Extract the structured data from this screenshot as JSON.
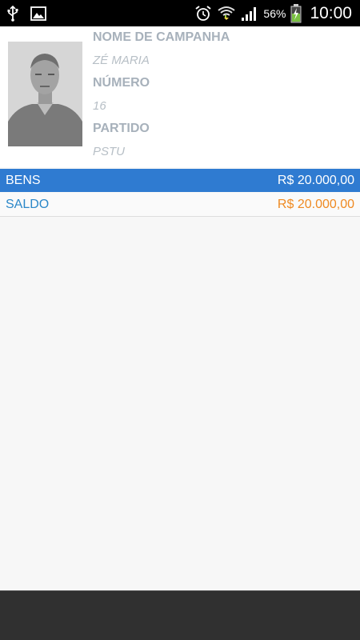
{
  "status_bar": {
    "icons_left": [
      "usb-icon",
      "image-icon"
    ],
    "icons_right": [
      "alarm-icon",
      "wifi-icon",
      "signal-icon",
      "battery-charging-icon"
    ],
    "battery_percent": "56%",
    "time": "10:00"
  },
  "candidate": {
    "campaign_name_label": "NOME DE CAMPANHA",
    "campaign_name": "ZÉ MARIA",
    "number_label": "NÚMERO",
    "number": "16",
    "party_label": "PARTIDO",
    "party": "PSTU"
  },
  "rows": {
    "bens": {
      "label": "BENS",
      "value": "R$ 20.000,00"
    },
    "saldo": {
      "label": "SALDO",
      "value": "R$ 20.000,00"
    }
  },
  "colors": {
    "accent_blue": "#2f7bd1",
    "saldo_label": "#2c88c9",
    "saldo_value": "#ef8a22"
  }
}
